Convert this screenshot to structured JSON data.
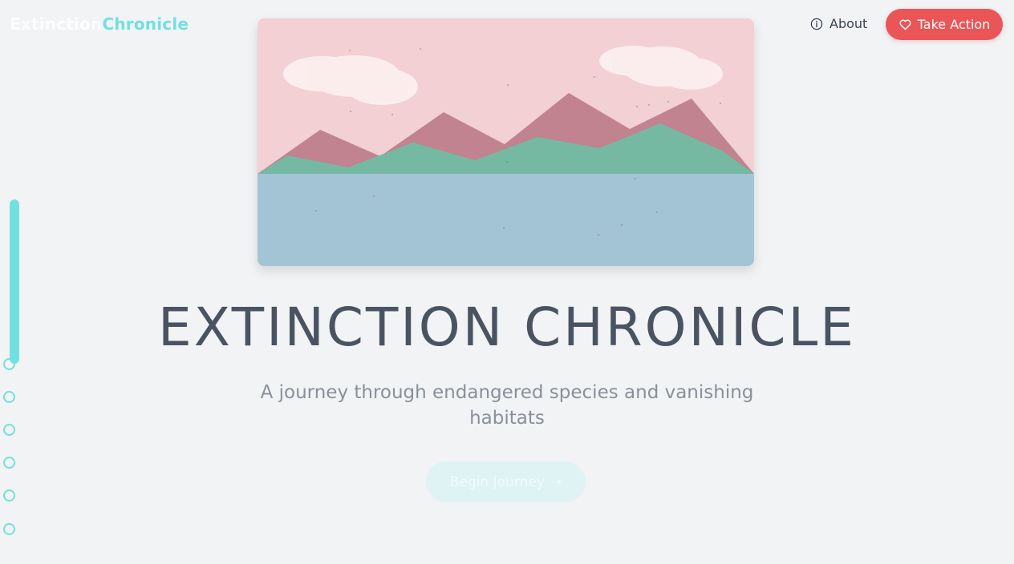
{
  "header": {
    "logo_part1": "Extinction",
    "logo_part2": "Chronicle",
    "about_label": "About",
    "cta_label": "Take Action"
  },
  "hero": {
    "title": "EXTINCTION CHRONICLE",
    "subtitle": "A journey through endangered species and vanishing habitats",
    "begin_label": "Begin Journey",
    "begin_arrow": "→"
  },
  "icons": {
    "about": "info-icon",
    "cta": "heart-icon",
    "begin": "arrow-right-icon"
  },
  "colors": {
    "accent": "#72e0e0",
    "cta": "#ea5557",
    "text": "#4a5361",
    "muted": "#8a9099",
    "sky": "#f3d0d3",
    "mountain": "#c0838f",
    "hills": "#75b9a3",
    "water": "#a3c4d5"
  },
  "progress": {
    "sections": 6,
    "current_section": 0
  }
}
